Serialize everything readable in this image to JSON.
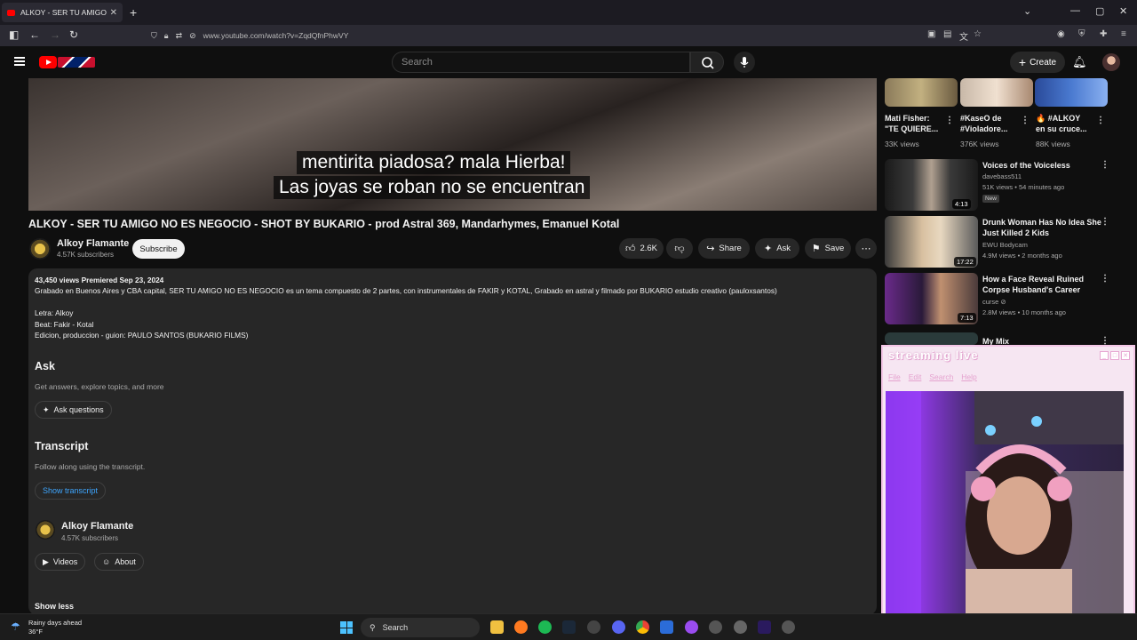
{
  "browser": {
    "tab_title": "ALKOY - SER TU AMIGO NO ES",
    "url": "www.youtube.com/watch?v=ZqdQfnPhwVY"
  },
  "header": {
    "search_placeholder": "Search",
    "create_label": "Create"
  },
  "video": {
    "caption_line1": "mentirita piadosa? mala Hierba!",
    "caption_line2": "Las joyas se roban no se encuentran",
    "title": "ALKOY - SER TU AMIGO NO ES NEGOCIO - SHOT BY BUKARIO - prod Astral 369, Mandarhymes, Emanuel Kotal"
  },
  "channel": {
    "name": "Alkoy Flamante",
    "subscribers": "4.57K subscribers",
    "subscribe_label": "Subscribe"
  },
  "actions": {
    "likes": "2.6K",
    "share": "Share",
    "ask": "Ask",
    "save": "Save"
  },
  "description": {
    "stats": "43,450 views  Premiered Sep 23, 2024",
    "line1": "Grabado en Buenos Aires y CBA capital, SER TU AMIGO NO ES NEGOCIO es un tema compuesto de 2 partes, con instrumentales de FAKIR y KOTAL, Grabado en astral y filmado por BUKARIO estudio creativo (pauloxsantos)",
    "line2": "Letra: Alkoy",
    "line3": "Beat: Fakir - Kotal",
    "line4": "Edicion, produccion - guion: PAULO SANTOS (BUKARIO FILMS)",
    "ask_heading": "Ask",
    "ask_sub": "Get answers, explore topics, and more",
    "ask_button": "Ask questions",
    "transcript_heading": "Transcript",
    "transcript_sub": "Follow along using the transcript.",
    "transcript_button": "Show transcript",
    "channel_name": "Alkoy Flamante",
    "channel_subs": "4.57K subscribers",
    "videos_button": "Videos",
    "about_button": "About",
    "show_less": "Show less"
  },
  "sidebar": {
    "shorts": [
      {
        "title1": "Mati Fisher:",
        "title2": "\"TE QUIERE...",
        "views": "33K views"
      },
      {
        "title1": "#KaseO de",
        "title2": "#Violadore...",
        "views": "376K views"
      },
      {
        "title1": "🔥 #ALKOY",
        "title2": "en su cruce...",
        "views": "88K views"
      }
    ],
    "videos": [
      {
        "title1": "Voices of the Voiceless",
        "title2": "",
        "channel": "davebass511",
        "meta": "51K views • 54 minutes ago",
        "badge": "New",
        "duration": "4:13"
      },
      {
        "title1": "Drunk Woman Has No Idea She",
        "title2": "Just Killed 2 Kids",
        "channel": "EWU Bodycam",
        "meta": "4.9M views • 2 months ago",
        "badge": "",
        "duration": "17:22"
      },
      {
        "title1": "How a Face Reveal Ruined",
        "title2": "Corpse Husband's Career",
        "channel": "curse ⊘",
        "meta": "2.8M views • 10 months ago",
        "badge": "",
        "duration": "7:13"
      },
      {
        "title1": "My Mix",
        "title2": "",
        "channel": "",
        "meta": "",
        "badge": "",
        "duration": ""
      }
    ]
  },
  "stream_window": {
    "title": "streaming live",
    "menu": [
      "File",
      "Edit",
      "Search",
      "Help"
    ]
  },
  "taskbar": {
    "weather1": "Rainy days ahead",
    "weather2": "36°F",
    "search": "Search"
  }
}
